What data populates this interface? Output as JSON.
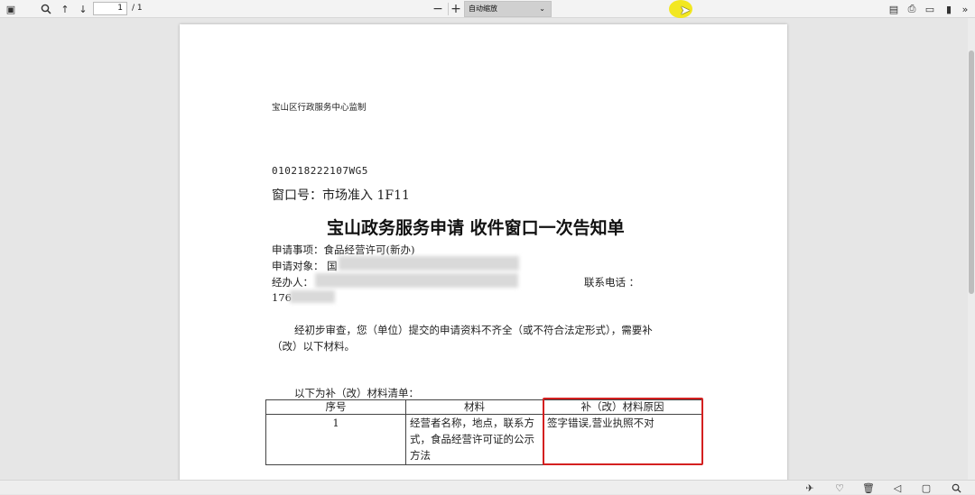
{
  "toolbar": {
    "page_current": "1",
    "page_total": "/ 1",
    "zoom_label": "自动缩放"
  },
  "document": {
    "header_note": "宝山区行政服务中心监制",
    "doc_code": "010218222107WG5",
    "window_no": "窗口号：市场准入 1F11",
    "title": "宝山政务服务申请  收件窗口一次告知单",
    "item_label": "申请事项：食品经营许可(新办)",
    "target_label": "申请对象：",
    "target_value": "国",
    "agent_label": "经办人：",
    "phone_label": "联系电话 ：",
    "phone_value": "176",
    "notice_line1": "经初步审查，您（单位）提交的申请资料不齐全（或不符合法定形式），需要补",
    "notice_line2": "（改）以下材料。",
    "list_heading": "以下为补（改）材料清单：",
    "table": {
      "headers": [
        "序号",
        "材料",
        "补（改）材料原因"
      ],
      "rows": [
        {
          "no": "1",
          "material": "经营者名称，地点，联系方式，食品经营许可证的公示方法",
          "reason": "签字错误,营业执照不对"
        }
      ]
    }
  }
}
